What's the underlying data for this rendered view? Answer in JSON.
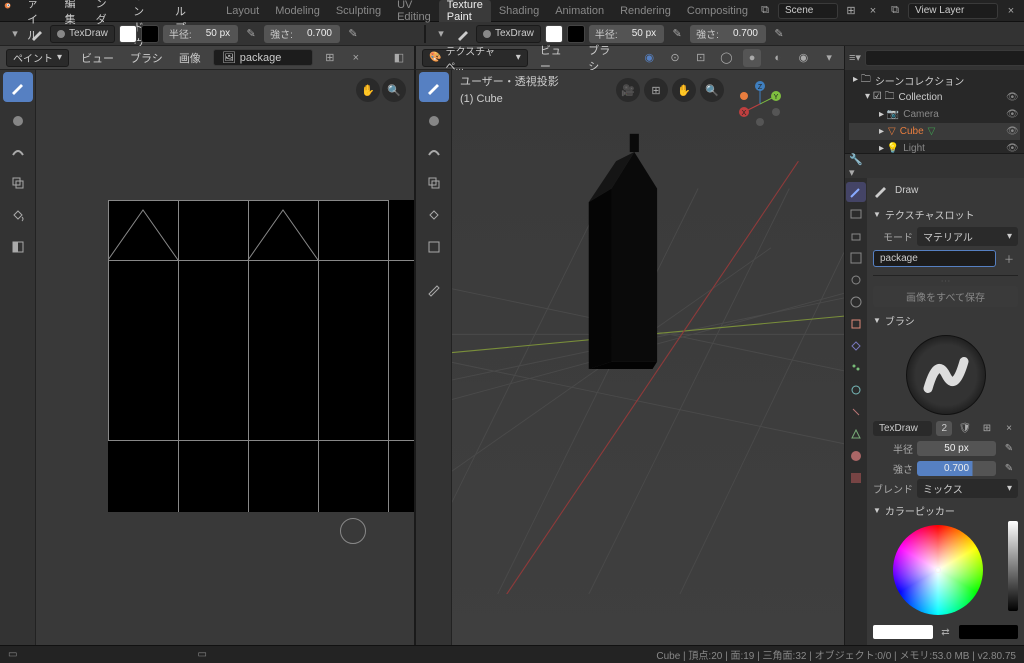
{
  "app": {
    "menus": [
      "ファイル",
      "編集",
      "レンダー",
      "ウィンドウ",
      "ヘルプ"
    ],
    "workspaces": [
      "Layout",
      "Modeling",
      "Sculpting",
      "UV Editing",
      "Texture Paint",
      "Shading",
      "Animation",
      "Rendering",
      "Compositing"
    ],
    "active_workspace": "Texture Paint",
    "scene_label": "Scene",
    "view_layer_label": "View Layer"
  },
  "tool_header_left": {
    "brush_name": "TexDraw",
    "radius_label": "半径:",
    "radius_value": "50 px",
    "strength_label": "強さ:",
    "strength_value": "0.700"
  },
  "tool_header_right": {
    "brush_name": "TexDraw",
    "radius_label": "半径:",
    "radius_value": "50 px",
    "strength_label": "強さ:",
    "strength_value": "0.700"
  },
  "sub_left": {
    "mode_label": "ペイント",
    "menus": [
      "ビュー",
      "ブラシ",
      "画像"
    ],
    "image_name": "package"
  },
  "sub_right": {
    "mode_label": "テクスチャペ...",
    "menus": [
      "ビュー",
      "ブラシ"
    ]
  },
  "viewport3d": {
    "line1": "ユーザー・透視投影",
    "line2": "(1) Cube"
  },
  "outliner": {
    "root": "シーンコレクション",
    "collection": "Collection",
    "items": [
      "Camera",
      "Cube",
      "Light"
    ]
  },
  "props": {
    "active_tool": "Draw",
    "tex_slot_header": "テクスチャスロット",
    "mode_label": "モード",
    "mode_value": "マテリアル",
    "slot_name": "package",
    "save_all": "画像をすべて保存",
    "brush_header": "ブラシ",
    "brush_name": "TexDraw",
    "brush_count": "2",
    "radius_label": "半径",
    "radius_value": "50 px",
    "strength_label": "強さ",
    "strength_value": "0.700",
    "blend_label": "ブレンド",
    "blend_value": "ミックス",
    "color_picker_header": "カラーピッカー"
  },
  "status": {
    "cube": "Cube",
    "verts_label": "頂点:",
    "verts": "20",
    "faces_label": "面:",
    "faces": "19",
    "tris_label": "三角面:",
    "tris": "32",
    "objects_label": "オブジェクト:",
    "objects": "0/0",
    "mem_label": "メモリ:",
    "mem": "53.0 MB",
    "version": "v2.80.75"
  }
}
